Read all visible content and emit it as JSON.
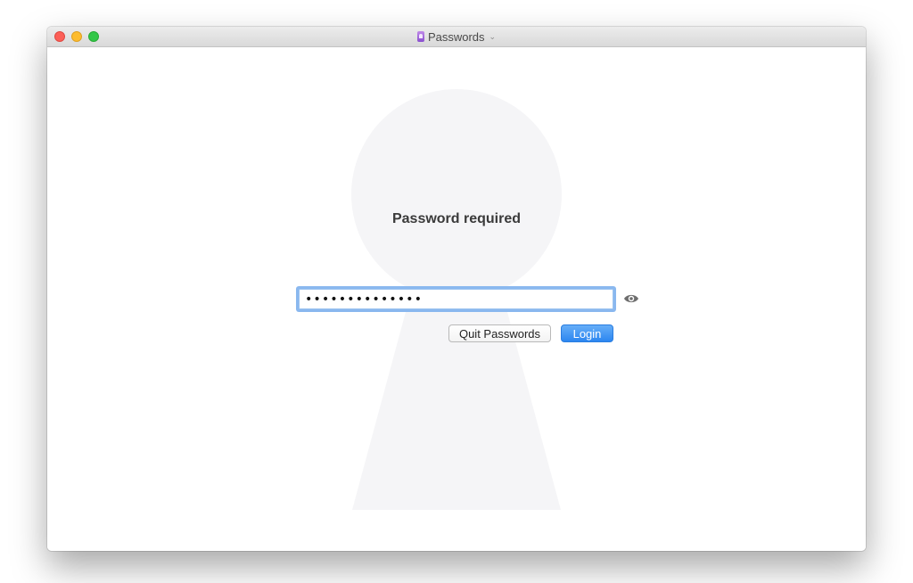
{
  "window": {
    "title": "Passwords",
    "title_chevron": "⌄"
  },
  "main": {
    "heading": "Password required",
    "password_field": {
      "value": "••••••••••••••",
      "type": "password"
    },
    "buttons": {
      "quit_label": "Quit Passwords",
      "login_label": "Login"
    }
  },
  "icons": {
    "app": "passwords-app-icon",
    "reveal": "eye-icon",
    "background": "keyhole-graphic"
  },
  "colors": {
    "close": "#fc5f57",
    "minimize": "#fdbc2e",
    "maximize": "#33c748",
    "accent": "#2c86f0",
    "focus_ring": "#8ab8ef",
    "keyhole": "#f5f5f7"
  }
}
